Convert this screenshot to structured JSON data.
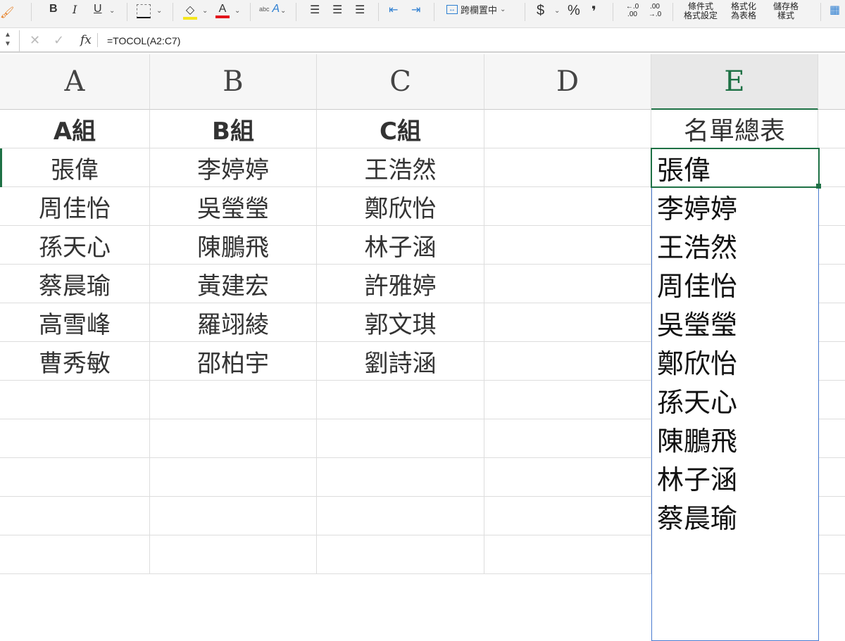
{
  "toolbar": {
    "bold": "B",
    "italic": "I",
    "underline": "U",
    "merge_center": "跨欄置中",
    "currency": "$",
    "percent": "%",
    "comma": "❜",
    "increase_decimal": "←.0 .00",
    "decrease_decimal": ".00 →.0",
    "conditional_format": "條件式\n格式設定",
    "format_as_table": "格式化\n為表格",
    "cell_styles": "儲存格\n樣式",
    "fill_color": "#f5e61e",
    "font_color": "#e3131b"
  },
  "formula_bar": {
    "formula": "=TOCOL(A2:C7)",
    "fx": "fx"
  },
  "columns": [
    "A",
    "B",
    "C",
    "D",
    "E"
  ],
  "selected_column": "E",
  "headers": [
    "A組",
    "B組",
    "C組",
    "",
    "名單總表"
  ],
  "table": [
    [
      "張偉",
      "李婷婷",
      "王浩然"
    ],
    [
      "周佳怡",
      "吳瑩瑩",
      "鄭欣怡"
    ],
    [
      "孫天心",
      "陳鵬飛",
      "林子涵"
    ],
    [
      "蔡晨瑜",
      "黃建宏",
      "許雅婷"
    ],
    [
      "高雪峰",
      "羅翊綾",
      "郭文琪"
    ],
    [
      "曹秀敏",
      "邵柏宇",
      "劉詩涵"
    ]
  ],
  "result": [
    "張偉",
    "李婷婷",
    "王浩然",
    "周佳怡",
    "吳瑩瑩",
    "鄭欣怡",
    "孫天心",
    "陳鵬飛",
    "林子涵",
    "蔡晨瑜"
  ]
}
